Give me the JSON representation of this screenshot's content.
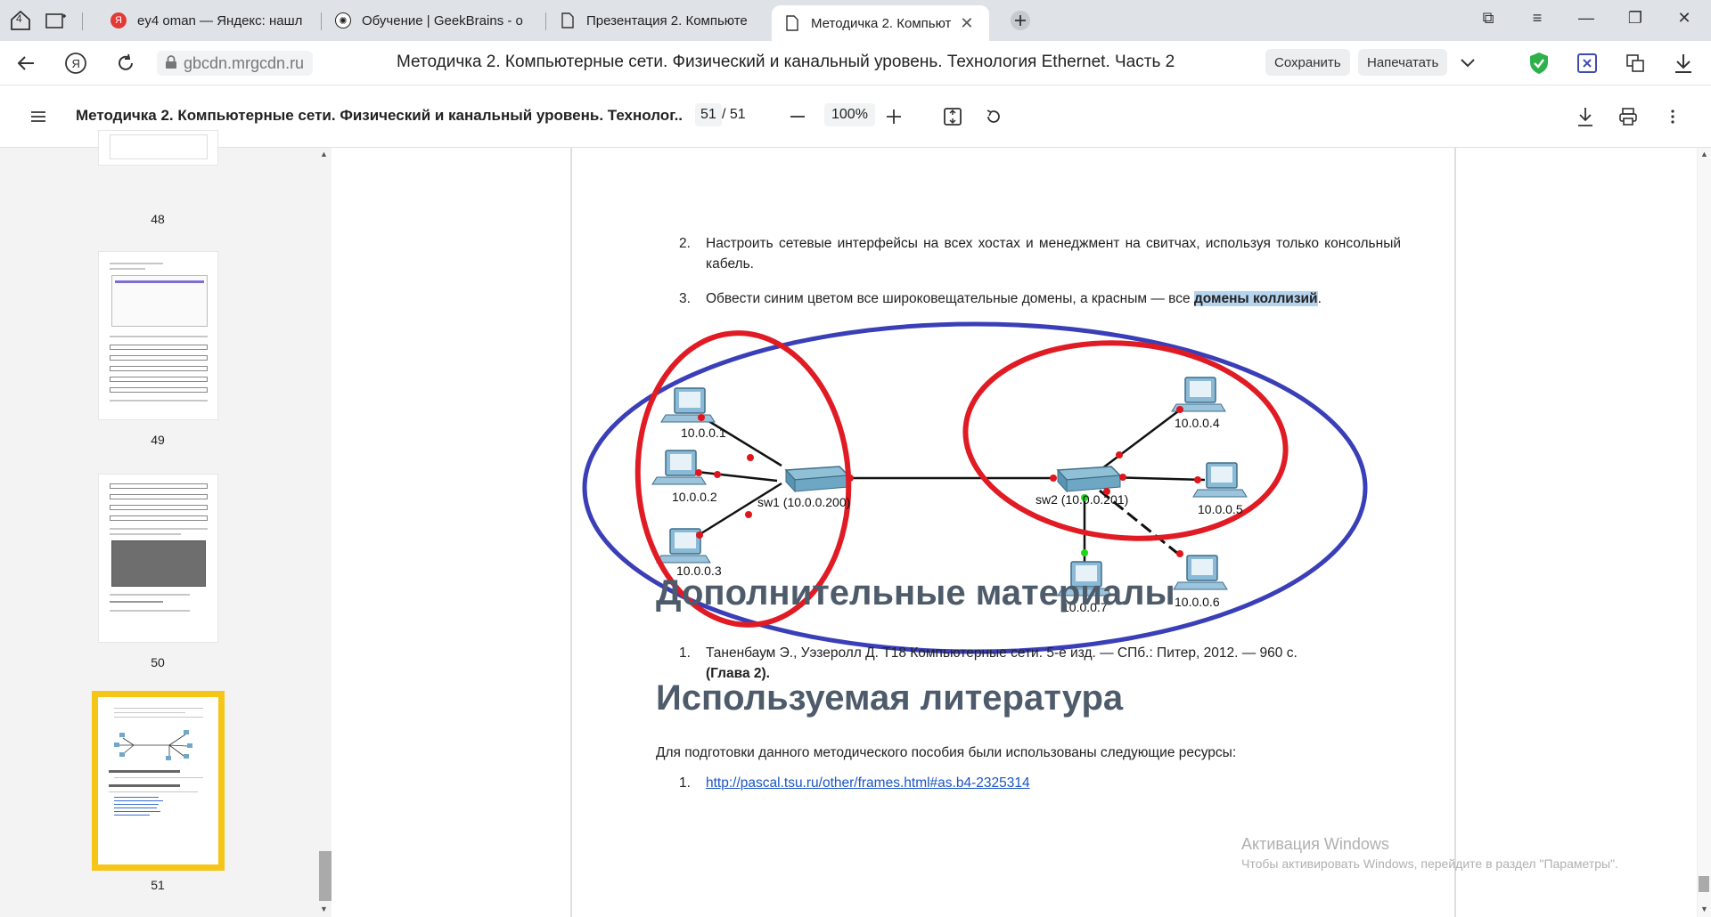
{
  "tabs": [
    {
      "title": "ey4 oman — Яндекс: нашл",
      "icon": "yandex-icon",
      "active": false
    },
    {
      "title": "Обучение | GeekBrains - о",
      "icon": "openai-icon",
      "active": false
    },
    {
      "title": "Презентация 2. Компьюте",
      "icon": "document-icon",
      "active": false
    },
    {
      "title": "Методичка 2. Компьют",
      "icon": "document-icon",
      "active": true
    }
  ],
  "tab_counter": "4",
  "address": {
    "domain": "gbcdn.mrgcdn.ru",
    "page_title": "Методичка 2. Компьютерные сети. Физический и канальный уровень. Технология Ethernet. Часть 2"
  },
  "toolbar": {
    "save": "Сохранить",
    "print": "Напечатать"
  },
  "pdf": {
    "title": "Методичка 2. Компьютерные сети. Физический и канальный уровень. Технолог...",
    "current_page": "51",
    "total_pages": "/ 51",
    "zoom": "100%"
  },
  "thumbnails": [
    {
      "label": "48"
    },
    {
      "label": "49"
    },
    {
      "label": "50"
    },
    {
      "label": "51"
    }
  ],
  "content": {
    "item2_num": "2.",
    "item2_text": "Настроить сетевые интерфейсы на всех хостах и менеджмент на свитчах, используя только консольный кабель.",
    "item3_num": "3.",
    "item3_text_a": "Обвести синим цветом все широковещательные домены, а красным — все ",
    "item3_text_hl": "домены коллизий",
    "item3_text_b": ".",
    "heading1": "Дополнительные материалы",
    "ref1_num": "1.",
    "ref1_text": "Таненбаум Э., Уэзеролл Д. Т18  Компьютерные сети. 5-е изд. — СПб.: Питер, 2012. — 960 с.",
    "ref1_bold": "(Глава 2).",
    "heading2": "Используемая литература",
    "lit_intro": "Для подготовки данного методического пособия были использованы следующие ресурсы:",
    "lit1_num": "1.",
    "lit1_link": "http://pascal.tsu.ru/other/frames.html#as.b4-2325314"
  },
  "diagram": {
    "hosts": [
      "10.0.0.1",
      "10.0.0.2",
      "10.0.0.3",
      "10.0.0.4",
      "10.0.0.5",
      "10.0.0.6",
      "10.0.0.7"
    ],
    "sw1": "sw1 (10.0.0.200)",
    "sw2": "sw2 (10.0.0.201)"
  },
  "watermark": {
    "title": "Активация Windows",
    "subtitle": "Чтобы активировать Windows, перейдите в раздел \"Параметры\"."
  },
  "colors": {
    "broadcast_ring": "#3a3fb8",
    "collision_ring": "#e01b24",
    "active_thumb_border": "#f5c518"
  }
}
